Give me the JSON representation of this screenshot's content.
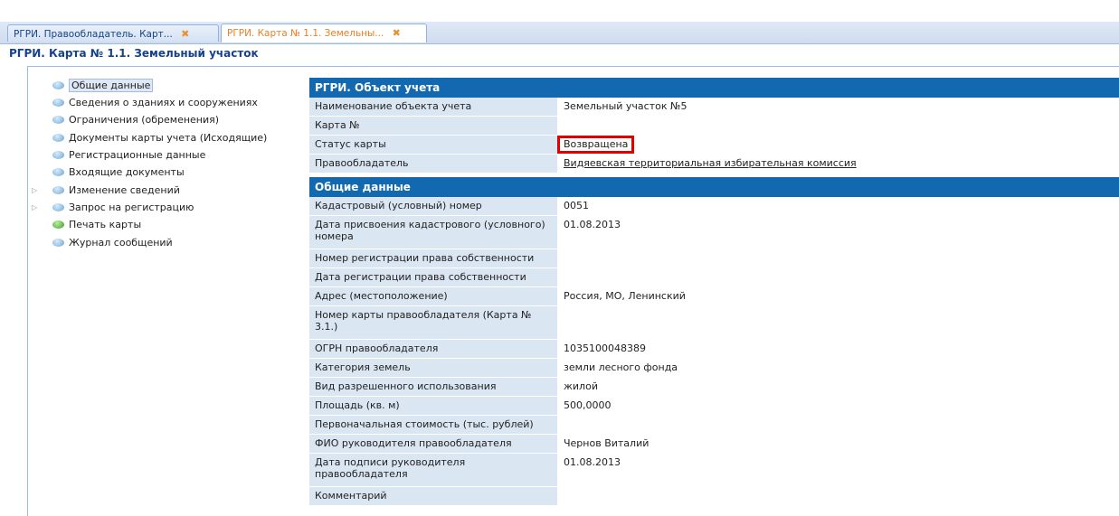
{
  "tabs": [
    {
      "label": "РГРИ. Правообладатель. Карт...",
      "close": "✖",
      "active": false
    },
    {
      "label": "РГРИ. Карта № 1.1. Земельны...",
      "close": "✖",
      "active": true
    }
  ],
  "page_title": "РГРИ. Карта № 1.1. Земельный участок",
  "tree": [
    {
      "label": "Общие данные",
      "icon": "info-icon",
      "selected": true
    },
    {
      "label": "Сведения о зданиях и сооружениях",
      "icon": "info-icon"
    },
    {
      "label": "Ограничения (обременения)",
      "icon": "info-icon"
    },
    {
      "label": "Документы карты учета (Исходящие)",
      "icon": "info-icon"
    },
    {
      "label": "Регистрационные данные",
      "icon": "info-icon"
    },
    {
      "label": "Входящие документы",
      "icon": "info-icon"
    },
    {
      "label": "Изменение сведений",
      "icon": "info-icon",
      "expander": "▷"
    },
    {
      "label": "Запрос на регистрацию",
      "icon": "info-icon",
      "expander": "▷"
    },
    {
      "label": "Печать карты",
      "icon": "print-icon"
    },
    {
      "label": "Журнал сообщений",
      "icon": "info-icon"
    }
  ],
  "section1": {
    "title": "РГРИ. Объект учета",
    "rows": [
      {
        "label": "Наименование объекта учета",
        "value": "Земельный участок №5"
      },
      {
        "label": "Карта №",
        "value": ""
      },
      {
        "label": "Статус карты",
        "value": "Возвращена"
      },
      {
        "label": "Правообладатель",
        "value": "Видяевская территориальная избирательная комиссия"
      }
    ]
  },
  "section2": {
    "title": "Общие данные",
    "rows": [
      {
        "label": "Кадастровый (условный) номер",
        "value": "0051"
      },
      {
        "label": "Дата присвоения кадастрового (условного) номера",
        "value": "01.08.2013"
      },
      {
        "label": "Номер регистрации права собственности",
        "value": ""
      },
      {
        "label": "Дата регистрации права собственности",
        "value": ""
      },
      {
        "label": "Адрес (местоположение)",
        "value": "Россия, МО, Ленинский"
      },
      {
        "label": "Номер карты правообладателя (Карта № 3.1.)",
        "value": ""
      },
      {
        "label": "ОГРН правообладателя",
        "value": "1035100048389"
      },
      {
        "label": "Категория земель",
        "value": "земли лесного фонда"
      },
      {
        "label": "Вид разрешенного использования",
        "value": "жилой"
      },
      {
        "label": "Площадь (кв. м)",
        "value": "500,0000"
      },
      {
        "label": "Первоначальная стоимость (тыс. рублей)",
        "value": ""
      },
      {
        "label": "ФИО руководителя правообладателя",
        "value": "Чернов Виталий"
      },
      {
        "label": "Дата подписи руководителя правообладателя",
        "value": "01.08.2013"
      },
      {
        "label": "Комментарий",
        "value": ""
      }
    ]
  }
}
